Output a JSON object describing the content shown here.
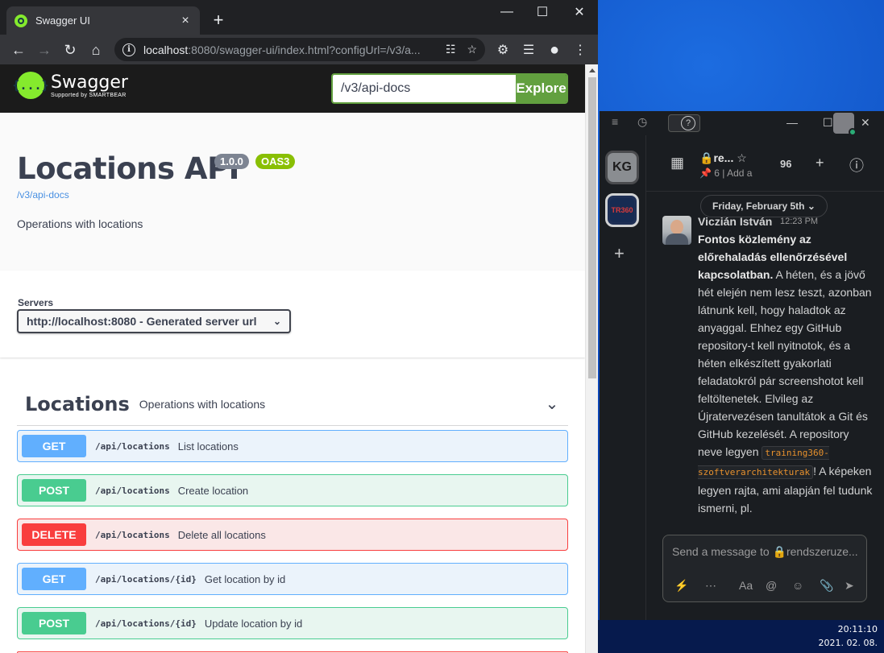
{
  "browser": {
    "tab_title": "Swagger UI",
    "url_host": "localhost",
    "url_rest": ":8080/swagger-ui/index.html?configUrl=/v3/a...",
    "tab_close": "×",
    "new_tab": "+"
  },
  "swagger": {
    "logo_word": "Swagger",
    "logo_sub": "Supported by SMARTBEAR",
    "logo_glyph": "{...}",
    "search_value": "/v3/api-docs",
    "explore_label": "Explore",
    "title": "Locations API",
    "version_badge": "1.0.0",
    "oas_badge": "OAS3",
    "spec_link": "/v3/api-docs",
    "description": "Operations with locations",
    "servers_label": "Servers",
    "server_selected": "http://localhost:8080 - Generated server url",
    "tag_name": "Locations",
    "tag_description": "Operations with locations",
    "operations": [
      {
        "method": "GET",
        "path": "/api/locations",
        "summary": "List locations"
      },
      {
        "method": "POST",
        "path": "/api/locations",
        "summary": "Create location"
      },
      {
        "method": "DELETE",
        "path": "/api/locations",
        "summary": "Delete all locations"
      },
      {
        "method": "GET",
        "path": "/api/locations/{id}",
        "summary": "Get location by id"
      },
      {
        "method": "POST",
        "path": "/api/locations/{id}",
        "summary": "Update location by id"
      }
    ]
  },
  "slack": {
    "ws1": "KG",
    "ws2": "TR360",
    "channel_name": "re...",
    "channel_members": "6",
    "channel_add": "Add a",
    "member_count": "96",
    "date_label": "Friday, February 5th",
    "author": "Viczián István",
    "time": "12:23 PM",
    "message_bold": "Fontos közlemény az előrehaladás ellenőrzésével kapcsolatban.",
    "message_part1": " A héten, és a jövő hét elején nem lesz teszt, azonban látnunk kell, hogy haladtok az anyaggal. Ehhez egy GitHub repository-t kell nyitnotok, és a héten elkészített gyakorlati feladatokról pár screenshotot kell feltöltenetek. Elvileg az Újratervezésen tanultátok a Git és GitHub kezelését. A repository neve legyen ",
    "message_code": "training360-szoftverarchitekturak",
    "message_part2": "! A képeken legyen rajta, ami alapján fel tudunk ismerni, pl.",
    "composer_placeholder": "Send a message to 🔒rendszeruze..."
  },
  "taskbar": {
    "time": "20:11:10",
    "date": "2021. 02. 08."
  },
  "colors": {
    "get": "#61affe",
    "post": "#49cc90",
    "delete": "#f93e3e",
    "swagger_green": "#85ea2d",
    "explore_green": "#62a03f"
  }
}
